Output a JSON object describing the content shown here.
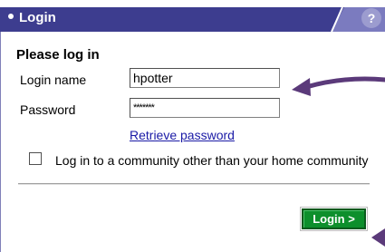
{
  "window": {
    "title": "Login",
    "help_icon": "?"
  },
  "form": {
    "heading": "Please log in",
    "login_name_label": "Login name",
    "login_name_value": "hpotter",
    "password_label": "Password",
    "password_value": "*******",
    "retrieve_link": "Retrieve password",
    "community_checkbox_label": "Log in to a community other than your home community",
    "community_checkbox_checked": false,
    "login_button": "Login >"
  },
  "colors": {
    "header_bg": "#3d3d8f",
    "login_button_bg": "#0d8f2c",
    "annotation_arrow": "#5b3a7a",
    "link": "#1a1aa6"
  }
}
